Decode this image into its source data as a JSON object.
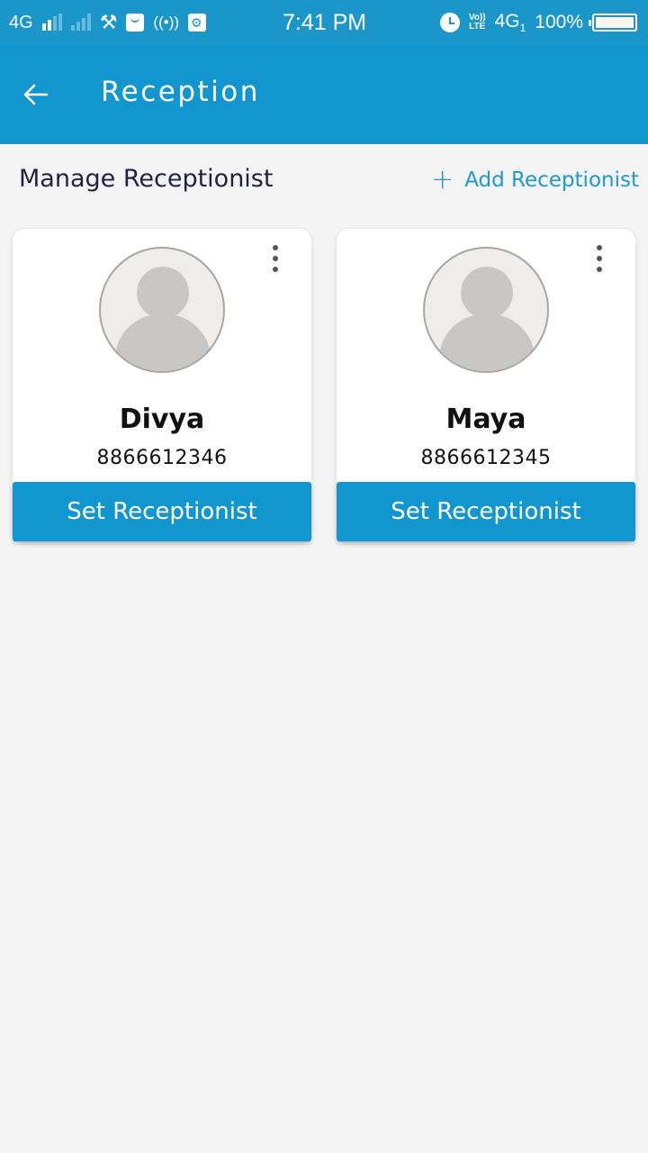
{
  "status_bar": {
    "network_left": "4G",
    "time": "7:41 PM",
    "volte_top": "Vo))",
    "volte_bottom": "LTE",
    "network_right": "4G",
    "sim_index": "1",
    "battery": "100%",
    "icons": [
      "signal-icon",
      "signal-faded-icon",
      "tools-icon",
      "shopping-bag-icon",
      "hotspot-icon",
      "usb-icon",
      "alarm-icon",
      "volte-icon",
      "battery-icon"
    ]
  },
  "app_bar": {
    "back_icon": "arrow-left-icon",
    "title": "Reception"
  },
  "section": {
    "title": "Manage Receptionist",
    "add_icon": "plus-icon",
    "add_label": "Add Receptionist"
  },
  "receptionists": [
    {
      "name": "Divya",
      "phone": "8866612346",
      "button_label": "Set Receptionist"
    },
    {
      "name": "Maya",
      "phone": "8866612345",
      "button_label": "Set Receptionist"
    }
  ],
  "colors": {
    "primary": "#1296d0",
    "status_bar": "#1a96cb",
    "background": "#f4f4f4",
    "heading_text": "#1e2440"
  }
}
